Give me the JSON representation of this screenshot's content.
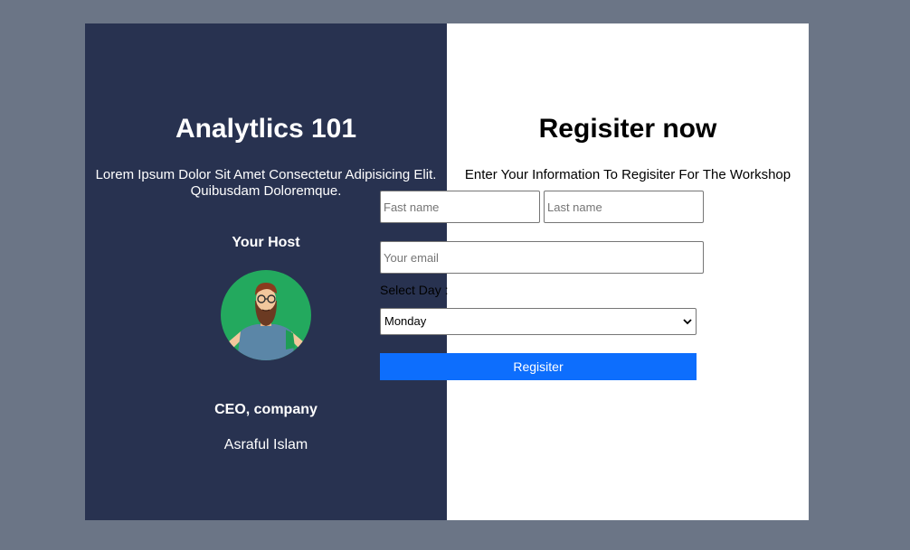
{
  "host_panel": {
    "title": "Analytlics 101",
    "description": "Lorem Ipsum Dolor Sit Amet Consectetur Adipisicing Elit. Quibusdam Doloremque.",
    "host_label": "Your Host",
    "avatar_icon": "bearded-man-avatar-icon",
    "host_role": "CEO, company",
    "host_name": "Asraful Islam"
  },
  "register_panel": {
    "title": "Regisiter now",
    "subtitle": "Enter Your Information To Regisiter For The Workshop",
    "first_name_placeholder": "Fast name",
    "last_name_placeholder": "Last name",
    "email_placeholder": "Your email",
    "select_label": "Select Day :",
    "select_value": "Monday",
    "submit_label": "Regisiter"
  },
  "colors": {
    "page_background": "#6b7586",
    "left_panel": "#283250",
    "avatar_background": "#23a95e",
    "submit_button": "#0d6efd"
  }
}
